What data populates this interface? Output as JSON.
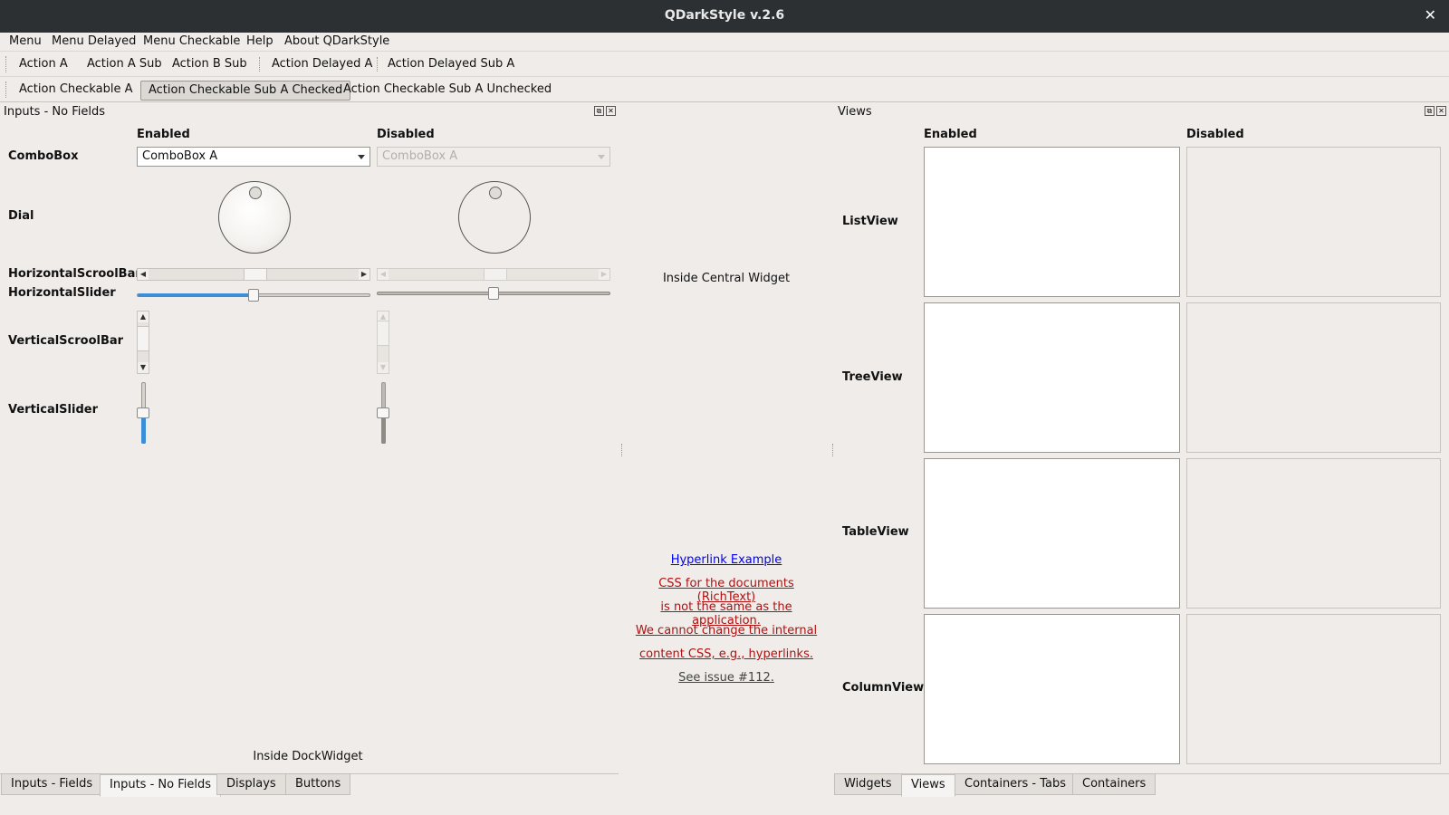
{
  "window": {
    "title": "QDarkStyle v.2.6",
    "close_glyph": "✕"
  },
  "menubar": [
    "Menu",
    "Menu Delayed",
    "Menu Checkable",
    "Help",
    "About QDarkStyle"
  ],
  "toolbar1": [
    "Action A",
    "Action A Sub",
    "Action B Sub",
    "Action Delayed A",
    "Action Delayed Sub A"
  ],
  "toolbar2": {
    "items": [
      "Action Checkable A",
      "Action Checkable Sub A Checked",
      "Action Checkable Sub A Unchecked"
    ],
    "checked_index": 1
  },
  "left_dock": {
    "title": "Inputs - No Fields",
    "header_enabled": "Enabled",
    "header_disabled": "Disabled",
    "labels": {
      "combobox": "ComboBox",
      "dial": "Dial",
      "hscroll": "HorizontalScroolBar",
      "hslider": "HorizontalSlider",
      "vscroll": "VerticalScroolBar",
      "vslider": "VerticalSlider"
    },
    "combo_enabled": "ComboBox A",
    "combo_disabled": "ComboBox A",
    "hslider_value": 0.5,
    "vslider_value": 0.5,
    "footer": "Inside DockWidget",
    "tabs": [
      "Inputs - Fields",
      "Inputs - No Fields",
      "Displays",
      "Buttons"
    ],
    "active_tab": 1
  },
  "central": {
    "text": "Inside Central Widget",
    "hyperlink": "Hyperlink Example",
    "note_lines": [
      "CSS for the documents (RichText)",
      "is not the same as the application.",
      "We cannot change the internal",
      "content CSS, e.g., hyperlinks."
    ],
    "issue_link": "See issue #112."
  },
  "right_dock": {
    "title": "Views",
    "header_enabled": "Enabled",
    "header_disabled": "Disabled",
    "labels": [
      "ListView",
      "TreeView",
      "TableView",
      "ColumnView"
    ],
    "tabs": [
      "Widgets",
      "Views",
      "Containers - Tabs",
      "Containers"
    ],
    "active_tab": 1
  },
  "colors": {
    "accent": "#3a8fd8",
    "titlebar": "#2d3032",
    "background": "#efece9",
    "hyperlink": "#0000ee",
    "note_red": "#b01010"
  }
}
